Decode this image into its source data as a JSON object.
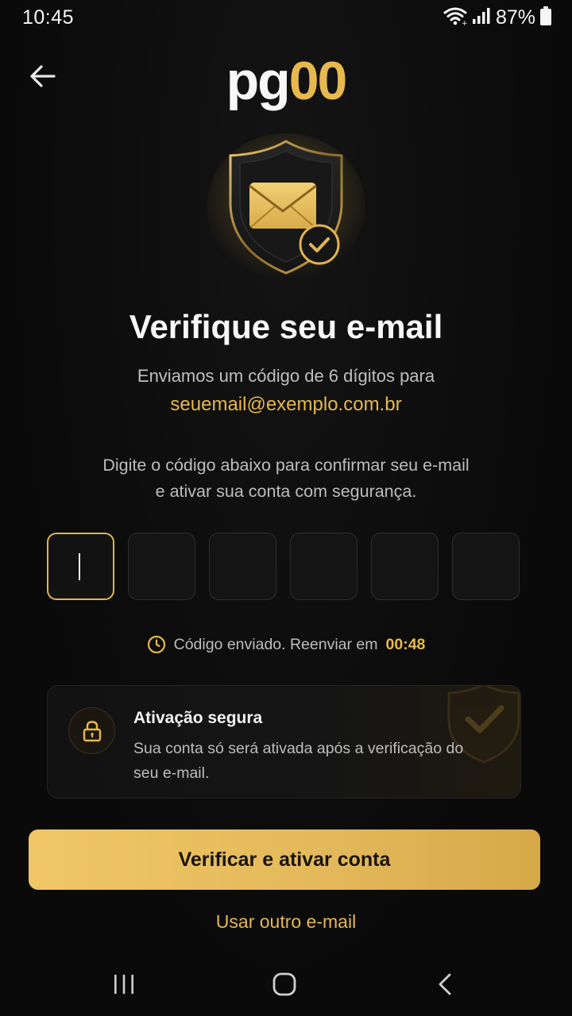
{
  "status_bar": {
    "time": "10:45",
    "battery_percent": "87%",
    "icons": [
      "wifi-icon",
      "signal-icon",
      "battery-icon"
    ]
  },
  "header": {
    "back_icon": "arrow-left-icon",
    "logo_part1": "pg",
    "logo_part2": "00"
  },
  "hero": {
    "icon": "shield-envelope-check-icon"
  },
  "main": {
    "title": "Verifique seu e-mail",
    "subtitle": "Enviamos um código de 6 dígitos para",
    "email": "seuemail@exemplo.com.br",
    "instruction_line1": "Digite o código abaixo para confirmar seu e-mail",
    "instruction_line2": "e ativar sua conta com segurança."
  },
  "code_inputs": {
    "digits": [
      "",
      "",
      "",
      "",
      "",
      ""
    ],
    "active_index": 0
  },
  "timer": {
    "icon": "clock-icon",
    "text": "Código enviado. Reenviar em",
    "countdown": "00:48"
  },
  "secure_card": {
    "icon": "lock-icon",
    "title": "Ativação segura",
    "description": "Sua conta só será ativada após a verificação do seu e-mail.",
    "background_icon": "shield-check-icon"
  },
  "actions": {
    "primary_label": "Verificar e ativar conta",
    "secondary_label": "Usar outro e-mail"
  },
  "nav_bar": {
    "icons": [
      "recent-apps-icon",
      "home-icon",
      "back-icon"
    ]
  },
  "colors": {
    "accent": "#e6b84d",
    "background": "#0c0c0c",
    "text_primary": "#f2f2f2",
    "text_secondary": "#bdbdbd"
  }
}
